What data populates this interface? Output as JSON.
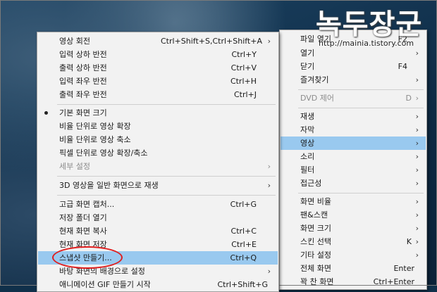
{
  "watermark": {
    "title": "녹두장군",
    "url": "http://mainia.tistory.com"
  },
  "main_menu": {
    "items": [
      {
        "label": "파일 열기",
        "shortcut": "F2"
      },
      {
        "label": "열기",
        "arrow": "›"
      },
      {
        "label": "닫기",
        "shortcut": "F4"
      },
      {
        "label": "즐겨찾기",
        "arrow": "›"
      },
      {
        "label": "DVD 제어",
        "shortcut": "D",
        "arrow": "›"
      },
      {
        "label": "재생",
        "arrow": "›"
      },
      {
        "label": "자막",
        "arrow": "›"
      },
      {
        "label": "영상",
        "arrow": "›"
      },
      {
        "label": "소리",
        "arrow": "›"
      },
      {
        "label": "필터",
        "arrow": "›"
      },
      {
        "label": "접근성",
        "arrow": "›"
      },
      {
        "label": "화면 비율",
        "arrow": "›"
      },
      {
        "label": "팬&스캔",
        "arrow": "›"
      },
      {
        "label": "화면 크기",
        "arrow": "›"
      },
      {
        "label": "스킨 선택",
        "shortcut": "K",
        "arrow": "›"
      },
      {
        "label": "기타 설정",
        "arrow": "›"
      },
      {
        "label": "전체 화면",
        "shortcut": "Enter"
      },
      {
        "label": "꽉 찬 화면",
        "shortcut": "Ctrl+Enter"
      }
    ]
  },
  "video_submenu": {
    "items": [
      {
        "label": "영상 회전",
        "shortcut": "Ctrl+Shift+S,Ctrl+Shift+A",
        "arrow": "›"
      },
      {
        "label": "입력 상하 반전",
        "shortcut": "Ctrl+Y"
      },
      {
        "label": "출력 상하 반전",
        "shortcut": "Ctrl+V"
      },
      {
        "label": "입력 좌우 반전",
        "shortcut": "Ctrl+H"
      },
      {
        "label": "출력 좌우 반전",
        "shortcut": "Ctrl+J"
      },
      {
        "label": "기본 화면 크기"
      },
      {
        "label": "비율 단위로 영상 확장"
      },
      {
        "label": "비율 단위로 영상 축소"
      },
      {
        "label": "픽셀 단위로 영상 확장/축소"
      },
      {
        "label": "세부 설정",
        "arrow": "›"
      },
      {
        "label": "3D 영상을 일반 화면으로 재생",
        "arrow": "›"
      },
      {
        "label": "고급 화면 캡처...",
        "shortcut": "Ctrl+G"
      },
      {
        "label": "저장 폴더 열기"
      },
      {
        "label": "현재 화면 복사",
        "shortcut": "Ctrl+C"
      },
      {
        "label": "현재 화면 저장",
        "shortcut": "Ctrl+E"
      },
      {
        "label": "스냅샷 만들기...",
        "shortcut": "Ctrl+Q"
      },
      {
        "label": "바탕 화면의 배경으로 설정",
        "arrow": "›"
      },
      {
        "label": "애니메이션 GIF 만들기 시작",
        "shortcut": "Ctrl+Shift+G"
      }
    ]
  }
}
